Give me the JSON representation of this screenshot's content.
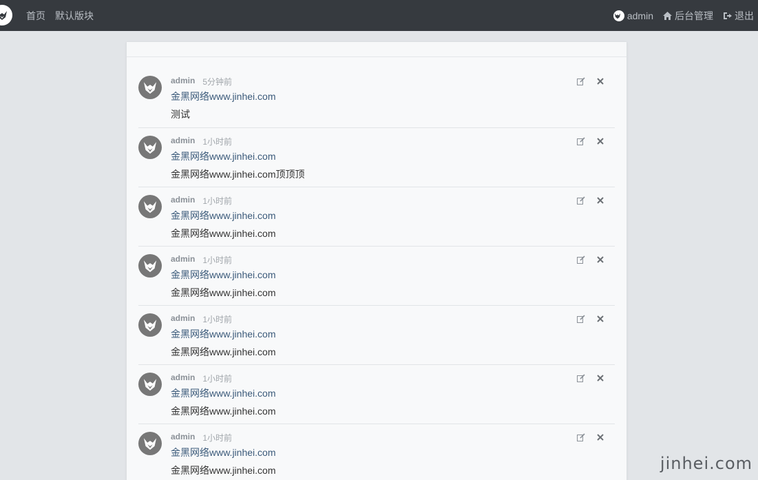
{
  "nav": {
    "links": [
      {
        "label": "首页"
      },
      {
        "label": "默认版块"
      }
    ],
    "user": "admin",
    "admin_label": "后台管理",
    "logout_label": "退出"
  },
  "posts": [
    {
      "author": "admin",
      "time": "5分钟前",
      "title": "金黑网络www.jinhei.com",
      "body": "测试"
    },
    {
      "author": "admin",
      "time": "1小时前",
      "title": "金黑网络www.jinhei.com",
      "body": "金黑网络www.jinhei.com顶顶顶"
    },
    {
      "author": "admin",
      "time": "1小时前",
      "title": "金黑网络www.jinhei.com",
      "body": "金黑网络www.jinhei.com"
    },
    {
      "author": "admin",
      "time": "1小时前",
      "title": "金黑网络www.jinhei.com",
      "body": "金黑网络www.jinhei.com"
    },
    {
      "author": "admin",
      "time": "1小时前",
      "title": "金黑网络www.jinhei.com",
      "body": "金黑网络www.jinhei.com"
    },
    {
      "author": "admin",
      "time": "1小时前",
      "title": "金黑网络www.jinhei.com",
      "body": "金黑网络www.jinhei.com"
    },
    {
      "author": "admin",
      "time": "1小时前",
      "title": "金黑网络www.jinhei.com",
      "body": "金黑网络www.jinhei.com"
    }
  ],
  "watermark": "jinhei.com",
  "colors": {
    "navbar": "#363a3f",
    "background": "#e2e5e8",
    "link": "#3b5a7a"
  }
}
